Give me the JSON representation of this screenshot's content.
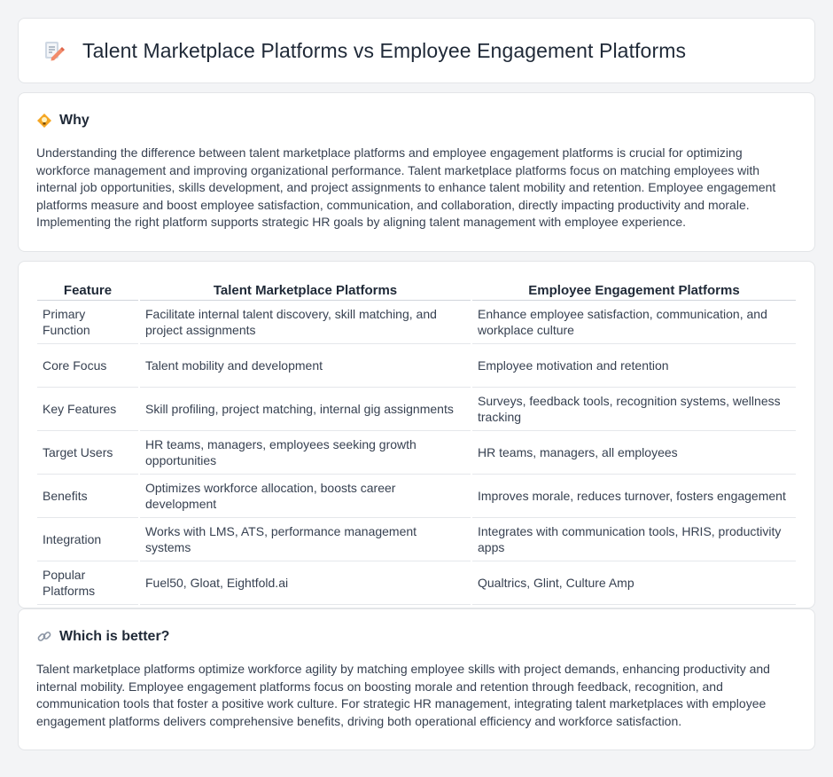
{
  "header": {
    "title": "Talent Marketplace Platforms vs Employee Engagement Platforms",
    "icon": "document-edit-icon"
  },
  "why": {
    "title": "Why",
    "icon": "lightbulb-icon",
    "text": "Understanding the difference between talent marketplace platforms and employee engagement platforms is crucial for optimizing workforce management and improving organizational performance. Talent marketplace platforms focus on matching employees with internal job opportunities, skills development, and project assignments to enhance talent mobility and retention. Employee engagement platforms measure and boost employee satisfaction, communication, and collaboration, directly impacting productivity and morale. Implementing the right platform supports strategic HR goals by aligning talent management with employee experience."
  },
  "table": {
    "headers": [
      "Feature",
      "Talent Marketplace Platforms",
      "Employee Engagement Platforms"
    ],
    "rows": [
      [
        "Primary Function",
        "Facilitate internal talent discovery, skill matching, and project assignments",
        "Enhance employee satisfaction, communication, and workplace culture"
      ],
      [
        "Core Focus",
        "Talent mobility and development",
        "Employee motivation and retention"
      ],
      [
        "Key Features",
        "Skill profiling, project matching, internal gig assignments",
        "Surveys, feedback tools, recognition systems, wellness tracking"
      ],
      [
        "Target Users",
        "HR teams, managers, employees seeking growth opportunities",
        "HR teams, managers, all employees"
      ],
      [
        "Benefits",
        "Optimizes workforce allocation, boosts career development",
        "Improves morale, reduces turnover, fosters engagement"
      ],
      [
        "Integration",
        "Works with LMS, ATS, performance management systems",
        "Integrates with communication tools, HRIS, productivity apps"
      ],
      [
        "Popular Platforms",
        "Fuel50, Gloat, Eightfold.ai",
        "Qualtrics, Glint, Culture Amp"
      ]
    ]
  },
  "better": {
    "title": "Which is better?",
    "icon": "link-icon",
    "text": "Talent marketplace platforms optimize workforce agility by matching employee skills with project demands, enhancing productivity and internal mobility. Employee engagement platforms focus on boosting morale and retention through feedback, recognition, and communication tools that foster a positive work culture. For strategic HR management, integrating talent marketplaces with employee engagement platforms delivers comprehensive benefits, driving both operational efficiency and workforce satisfaction."
  }
}
